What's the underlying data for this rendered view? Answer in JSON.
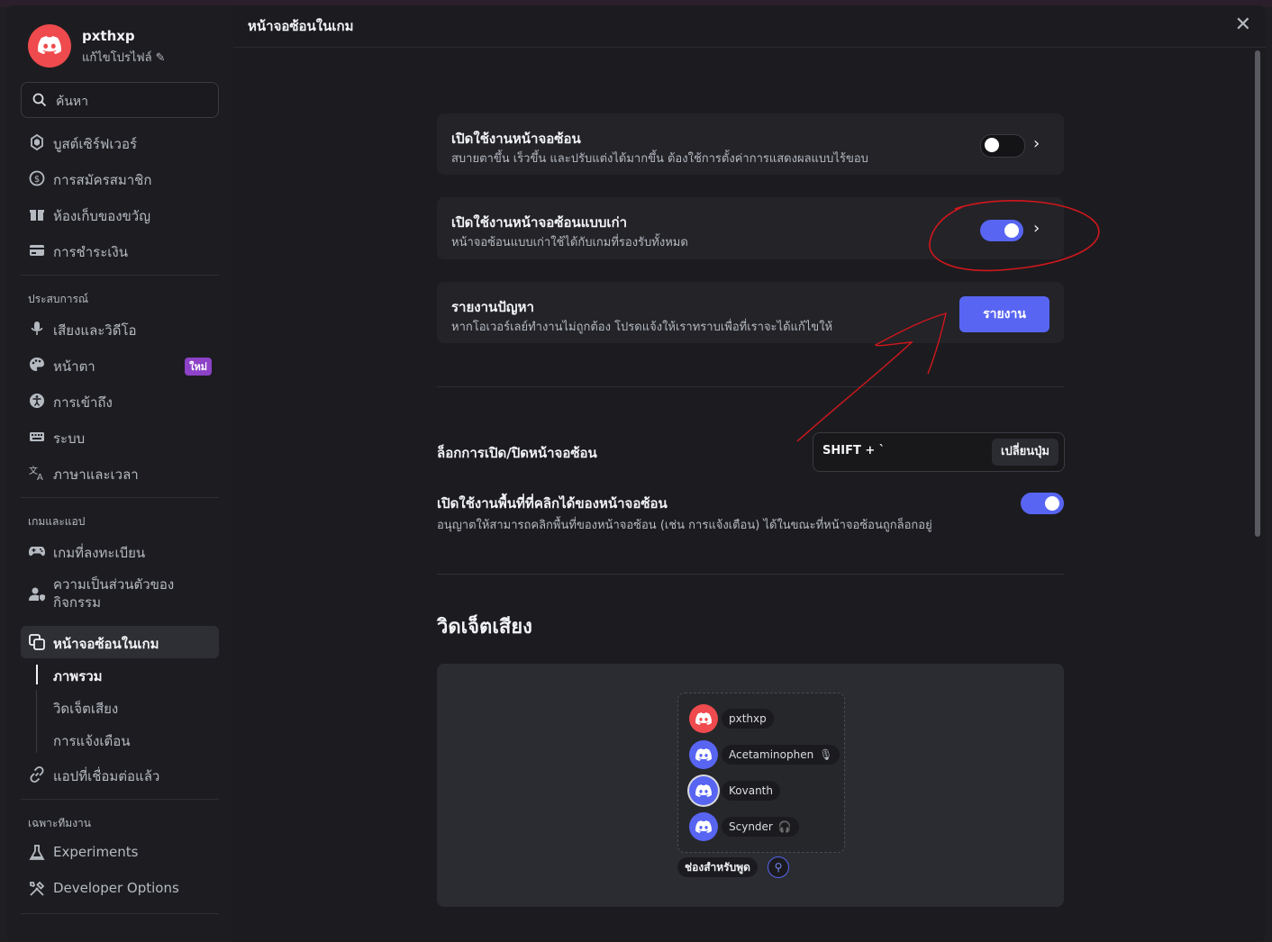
{
  "profile": {
    "name": "pxthxp",
    "edit_label": "แก้ไขโปรไฟล์"
  },
  "search": {
    "placeholder": "ค้นหา"
  },
  "nav": {
    "boost": "บูสต์เซิร์ฟเวอร์",
    "subscriptions": "การสมัครสมาชิก",
    "gift_inventory": "ห้องเก็บของขวัญ",
    "billing": "การชำระเงิน",
    "section_experience": "ประสบการณ์",
    "voice_video": "เสียงและวิดีโอ",
    "appearance": "หน้าตา",
    "appearance_badge": "ใหม่",
    "accessibility": "การเข้าถึง",
    "system": "ระบบ",
    "language_time": "ภาษาและเวลา",
    "section_games": "เกมและแอป",
    "registered_games": "เกมที่ลงทะเบียน",
    "activity_privacy": "ความเป็นส่วนตัวของกิจกรรม",
    "overlay": "หน้าจอซ้อนในเกม",
    "overlay_overview": "ภาพรวม",
    "overlay_voice_widget": "วิดเจ็ตเสียง",
    "overlay_notifications": "การแจ้งเตือน",
    "connected_apps": "แอปที่เชื่อมต่อแล้ว",
    "section_staff": "เฉพาะทีมงาน",
    "experiments": "Experiments",
    "developer_options": "Developer Options"
  },
  "main": {
    "title": "หน้าจอซ้อนในเกม",
    "enable_overlay": {
      "title": "เปิดใช้งานหน้าจอซ้อน",
      "desc": "สบายตาขึ้น เร็วขึ้น และปรับแต่งได้มากขึ้น ต้องใช้การตั้งค่าการแสดงผลแบบไร้ขอบ",
      "enabled": false
    },
    "legacy_overlay": {
      "title": "เปิดใช้งานหน้าจอซ้อนแบบเก่า",
      "desc": "หน้าจอซ้อนแบบเก่าใช้ได้กับเกมที่รองรับทั้งหมด",
      "enabled": true
    },
    "report": {
      "title": "รายงานปัญหา",
      "desc": "หากโอเวอร์เลย์ทำงานไม่ถูกต้อง โปรดแจ้งให้เราทราบเพื่อที่เราจะได้แก้ไขให้",
      "button": "รายงาน"
    },
    "lock_overlay": {
      "title": "ล็อกการเปิด/ปิดหน้าจอซ้อน",
      "keybind": "SHIFT + `",
      "change_button": "เปลี่ยนปุ่ม"
    },
    "clickable_zones": {
      "title": "เปิดใช้งานพื้นที่ที่คลิกได้ของหน้าจอซ้อน",
      "desc": "อนุญาตให้สามารถคลิกพื้นที่ของหน้าจอซ้อน (เช่น การแจ้งเตือน) ได้ในขณะที่หน้าจอซ้อนถูกล็อกอยู่",
      "enabled": true
    },
    "voice_widget_heading": "วิดเจ็ตเสียง",
    "preview": {
      "users": [
        {
          "name": "pxthxp",
          "avatar_color": "#ef4a4d",
          "icon": ""
        },
        {
          "name": "Acetaminophen",
          "avatar_color": "#5865f2",
          "icon": "mic-muted-icon"
        },
        {
          "name": "Kovanth",
          "avatar_color": "#5865f2",
          "icon": ""
        },
        {
          "name": "Scynder",
          "avatar_color": "#5865f2",
          "icon": "headset-muted-icon"
        }
      ],
      "channel_label": "ช่องสำหรับพูด"
    }
  },
  "colors": {
    "accent": "#5865f2",
    "danger": "#ef4a4d",
    "annotation": "#d0171c"
  }
}
